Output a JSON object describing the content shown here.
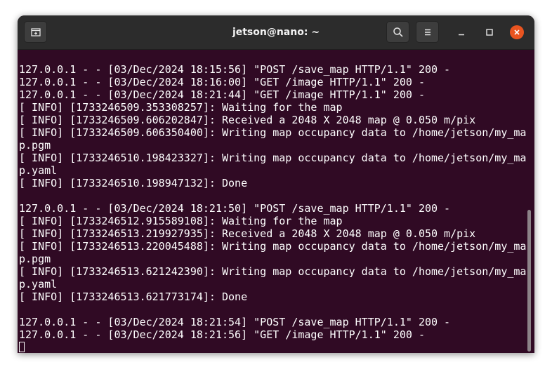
{
  "window": {
    "title": "jetson@nano: ~"
  },
  "titlebar": {
    "new_tab_icon": "new-tab-icon",
    "search_icon": "search-icon",
    "menu_icon": "hamburger-menu-icon",
    "minimize_icon": "minimize-icon",
    "maximize_icon": "maximize-icon",
    "close_icon": "close-icon",
    "close_color": "#e95420"
  },
  "terminal": {
    "background": "#300a24",
    "foreground": "#ffffff",
    "lines": [
      "127.0.0.1 - - [03/Dec/2024 18:15:56] \"POST /save_map HTTP/1.1\" 200 -",
      "127.0.0.1 - - [03/Dec/2024 18:16:00] \"GET /image HTTP/1.1\" 200 -",
      "127.0.0.1 - - [03/Dec/2024 18:21:44] \"GET /image HTTP/1.1\" 200 -",
      "[ INFO] [1733246509.353308257]: Waiting for the map",
      "[ INFO] [1733246509.606202847]: Received a 2048 X 2048 map @ 0.050 m/pix",
      "[ INFO] [1733246509.606350400]: Writing map occupancy data to /home/jetson/my_ma",
      "p.pgm",
      "[ INFO] [1733246510.198423327]: Writing map occupancy data to /home/jetson/my_ma",
      "p.yaml",
      "[ INFO] [1733246510.198947132]: Done",
      "",
      "127.0.0.1 - - [03/Dec/2024 18:21:50] \"POST /save_map HTTP/1.1\" 200 -",
      "[ INFO] [1733246512.915589108]: Waiting for the map",
      "[ INFO] [1733246513.219927935]: Received a 2048 X 2048 map @ 0.050 m/pix",
      "[ INFO] [1733246513.220045488]: Writing map occupancy data to /home/jetson/my_ma",
      "p.pgm",
      "[ INFO] [1733246513.621242390]: Writing map occupancy data to /home/jetson/my_ma",
      "p.yaml",
      "[ INFO] [1733246513.621773174]: Done",
      "",
      "127.0.0.1 - - [03/Dec/2024 18:21:54] \"POST /save_map HTTP/1.1\" 200 -",
      "127.0.0.1 - - [03/Dec/2024 18:21:56] \"GET /image HTTP/1.1\" 200 -",
      ""
    ]
  }
}
